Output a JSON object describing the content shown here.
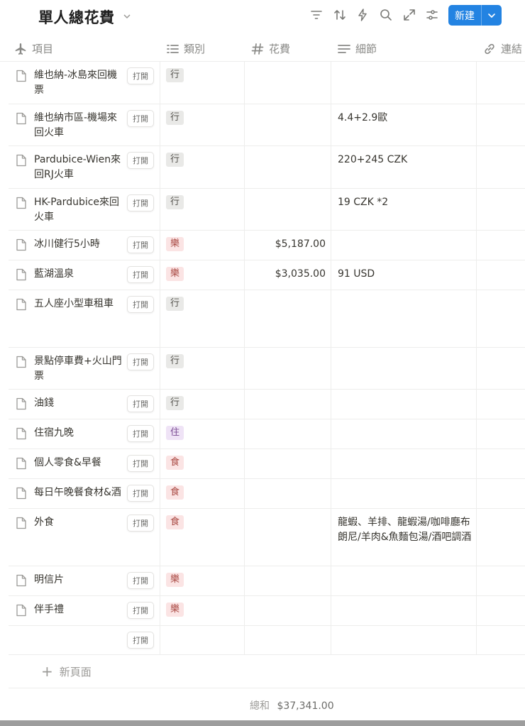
{
  "header": {
    "title": "單人總花費",
    "new_label": "新建"
  },
  "columns": {
    "item": "項目",
    "category": "類別",
    "cost": "花費",
    "detail": "細節",
    "link": "連結"
  },
  "open_label": "打開",
  "rows": [
    {
      "title": "維也納-冰島來回機票",
      "tag": "行",
      "amount": "",
      "detail": ""
    },
    {
      "title": "維也納市區-機場來回火車",
      "tag": "行",
      "amount": "",
      "detail": "4.4+2.9歐"
    },
    {
      "title": "Pardubice-Wien來回RJ火車",
      "tag": "行",
      "amount": "",
      "detail": "220+245 CZK"
    },
    {
      "title": "HK-Pardubice來回火車",
      "tag": "行",
      "amount": "",
      "detail": "19 CZK *2"
    },
    {
      "title": "冰川健行5小時",
      "tag": "樂",
      "amount": "$5,187.00",
      "detail": ""
    },
    {
      "title": "藍湖溫泉",
      "tag": "樂",
      "amount": "$3,035.00",
      "detail": "91 USD"
    },
    {
      "title": "五人座小型車租車",
      "tag": "行",
      "amount": "",
      "detail": ""
    },
    {
      "title": "景點停車費+火山門票",
      "tag": "行",
      "amount": "",
      "detail": ""
    },
    {
      "title": "油錢",
      "tag": "行",
      "amount": "",
      "detail": ""
    },
    {
      "title": "住宿九晚",
      "tag": "住",
      "amount": "",
      "detail": ""
    },
    {
      "title": "個人零食&早餐",
      "tag": "食",
      "amount": "",
      "detail": ""
    },
    {
      "title": "每日午晚餐食材&酒",
      "tag": "食",
      "amount": "",
      "detail": ""
    },
    {
      "title": "外食",
      "tag": "食",
      "amount": "",
      "detail": "龍蝦、羊排、龍蝦湯/咖啡廳布朗尼/羊肉&魚麵包湯/酒吧調酒"
    },
    {
      "title": "明信片",
      "tag": "樂",
      "amount": "",
      "detail": ""
    },
    {
      "title": "伴手禮",
      "tag": "樂",
      "amount": "",
      "detail": ""
    },
    {
      "title": "",
      "tag": "",
      "amount": "",
      "detail": ""
    }
  ],
  "tag_colors": {
    "行": {
      "bg": "#e9e9e7",
      "fg": "#55534e"
    },
    "樂": {
      "bg": "#fbe4e4",
      "fg": "#a94a44"
    },
    "住": {
      "bg": "#efe3f6",
      "fg": "#7a4b93"
    },
    "食": {
      "bg": "#fbe4e4",
      "fg": "#a94a44"
    }
  },
  "footer": {
    "new_page_label": "新頁面",
    "sum_label": "總和",
    "sum_value": "$37,341.00"
  },
  "accent_color": "#2383e2"
}
